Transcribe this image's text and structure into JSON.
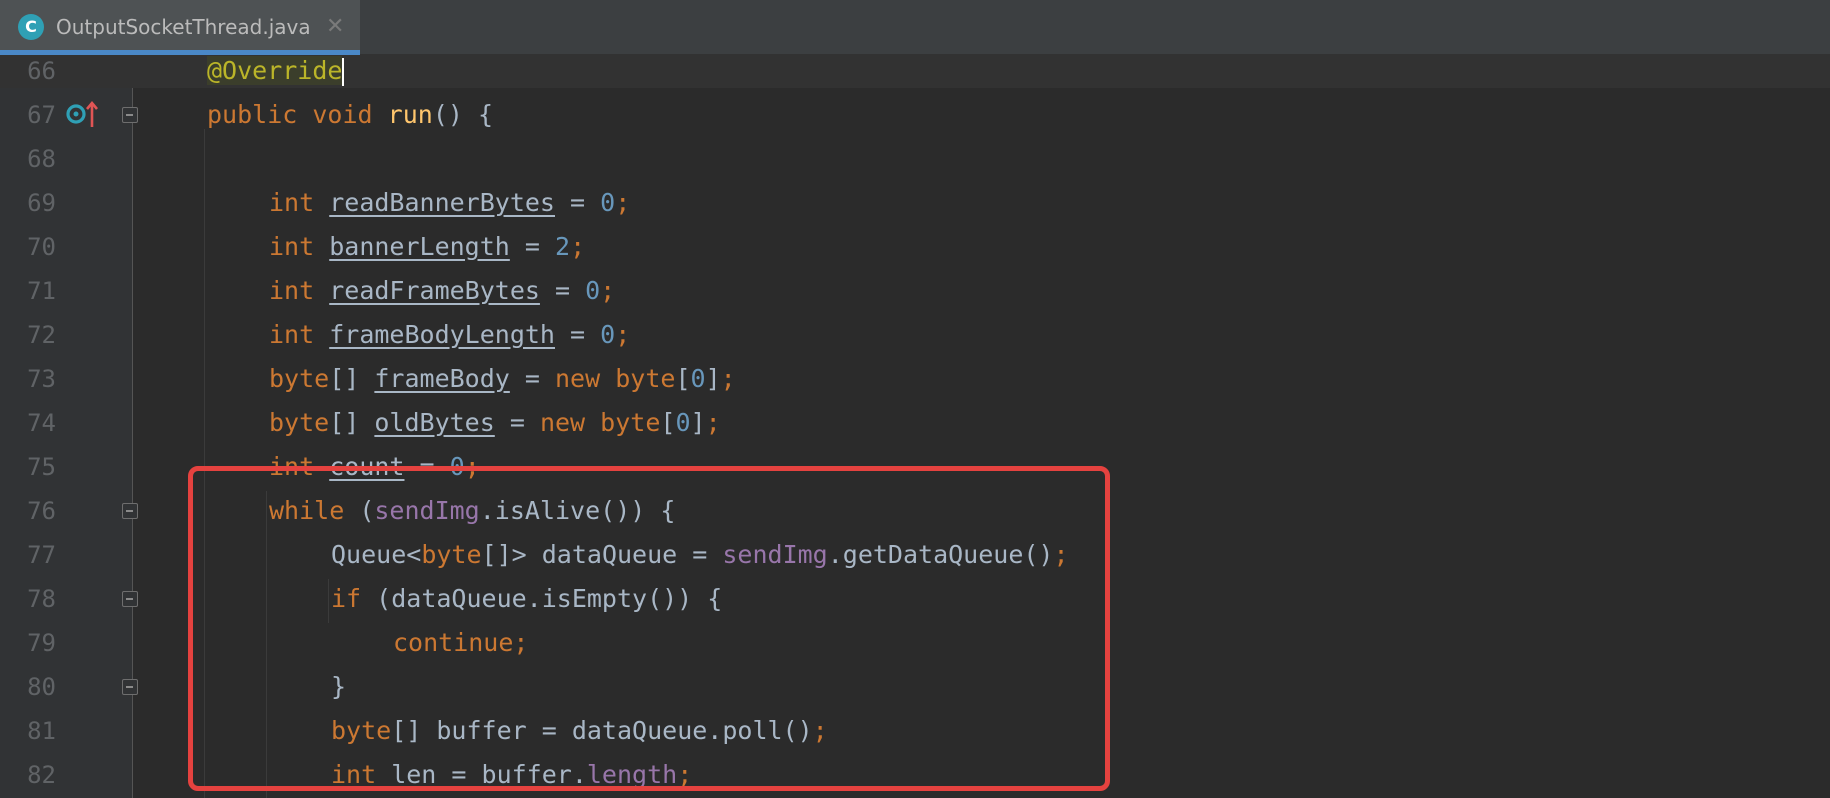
{
  "tab": {
    "icon_letter": "C",
    "title": "OutputSocketThread.java",
    "close_glyph": "✕"
  },
  "editor": {
    "lines": [
      {
        "n": "66"
      },
      {
        "n": "67"
      },
      {
        "n": "68"
      },
      {
        "n": "69"
      },
      {
        "n": "70"
      },
      {
        "n": "71"
      },
      {
        "n": "72"
      },
      {
        "n": "73"
      },
      {
        "n": "74"
      },
      {
        "n": "75"
      },
      {
        "n": "76"
      },
      {
        "n": "77"
      },
      {
        "n": "78"
      },
      {
        "n": "79"
      },
      {
        "n": "80"
      },
      {
        "n": "81"
      },
      {
        "n": "82"
      }
    ],
    "tokens": {
      "override": "@Override",
      "public": "public",
      "void": "void",
      "run": "run",
      "run_parens": "() {",
      "int": "int",
      "byte": "byte",
      "new": "new",
      "while": "while",
      "if": "if",
      "continue": "continue;",
      "length": "length",
      "v_readBannerBytes": "readBannerBytes",
      "v_bannerLength": "bannerLength",
      "v_readFrameBytes": "readFrameBytes",
      "v_frameBodyLength": "frameBodyLength",
      "v_frameBody": "frameBody",
      "v_oldBytes": "oldBytes",
      "v_count": "count",
      "sendImg": "sendImg",
      "zero": "0",
      "two": "2"
    }
  },
  "colors": {
    "keyword": "#cc7832",
    "method": "#ffc66d",
    "number": "#6897bb",
    "field": "#9876aa",
    "annotation": "#bbb529",
    "text": "#a9b7c6",
    "highlight_box": "#e5423f",
    "tab_accent": "#4a88c7"
  },
  "icons": {
    "tab_file": "java-class-icon",
    "gutter_override": "override-method-icon",
    "fold": "fold-marker-icon"
  }
}
